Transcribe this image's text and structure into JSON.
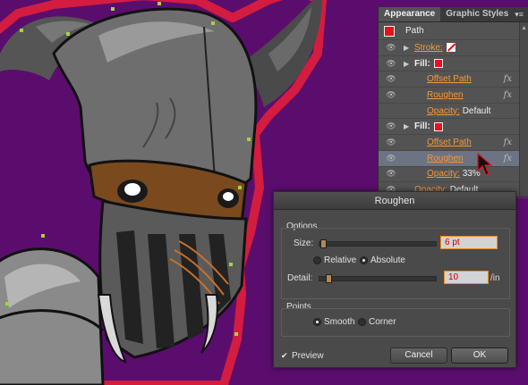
{
  "colors": {
    "background": "#5b0d6e",
    "accent": "#f29a3a",
    "fill_red": "#e8101a",
    "glow": "#e01e3a"
  },
  "appearance_panel": {
    "tabs": [
      {
        "label": "Appearance",
        "active": true
      },
      {
        "label": "Graphic Styles",
        "active": false
      }
    ],
    "header": "Path",
    "rows": [
      {
        "indent": 0,
        "has_eye": true,
        "has_triangle": true,
        "label": "Stroke:",
        "link": true,
        "swatch": "stroke",
        "fx": false,
        "selected": false
      },
      {
        "indent": 0,
        "has_eye": true,
        "has_triangle": true,
        "label": "Fill:",
        "link": false,
        "swatch": "red",
        "fx": false,
        "selected": false
      },
      {
        "indent": 1,
        "has_eye": true,
        "has_triangle": false,
        "label": "Offset Path",
        "link": true,
        "swatch": null,
        "fx": true,
        "selected": false
      },
      {
        "indent": 1,
        "has_eye": true,
        "has_triangle": false,
        "label": "Roughen",
        "link": true,
        "swatch": null,
        "fx": true,
        "selected": false
      },
      {
        "indent": 1,
        "has_eye": false,
        "has_triangle": false,
        "label": "Opacity:",
        "link": true,
        "value": "Default",
        "swatch": null,
        "fx": false,
        "selected": false
      },
      {
        "indent": 0,
        "has_eye": true,
        "has_triangle": true,
        "label": "Fill:",
        "link": false,
        "swatch": "red",
        "fx": false,
        "selected": false
      },
      {
        "indent": 1,
        "has_eye": true,
        "has_triangle": false,
        "label": "Offset Path",
        "link": true,
        "swatch": null,
        "fx": true,
        "selected": false
      },
      {
        "indent": 1,
        "has_eye": true,
        "has_triangle": false,
        "label": "Roughen",
        "link": true,
        "swatch": null,
        "fx": true,
        "selected": true
      },
      {
        "indent": 1,
        "has_eye": true,
        "has_triangle": false,
        "label": "Opacity:",
        "link": true,
        "value": "33%",
        "swatch": null,
        "fx": false,
        "selected": false
      },
      {
        "indent": 0,
        "has_eye": true,
        "has_triangle": false,
        "label": "Opacity:",
        "link": true,
        "value": "Default",
        "swatch": null,
        "fx": false,
        "selected": false
      }
    ]
  },
  "dialog": {
    "title": "Roughen",
    "options_label": "Options",
    "size_label": "Size:",
    "size_value": "6 pt",
    "relative_label": "Relative",
    "absolute_label": "Absolute",
    "measure_selected": "Absolute",
    "detail_label": "Detail:",
    "detail_value": "10",
    "detail_unit": "/in",
    "points_label": "Points",
    "smooth_label": "Smooth",
    "corner_label": "Corner",
    "points_selected": "Smooth",
    "preview_label": "Preview",
    "preview_checked": true,
    "cancel_label": "Cancel",
    "ok_label": "OK"
  }
}
